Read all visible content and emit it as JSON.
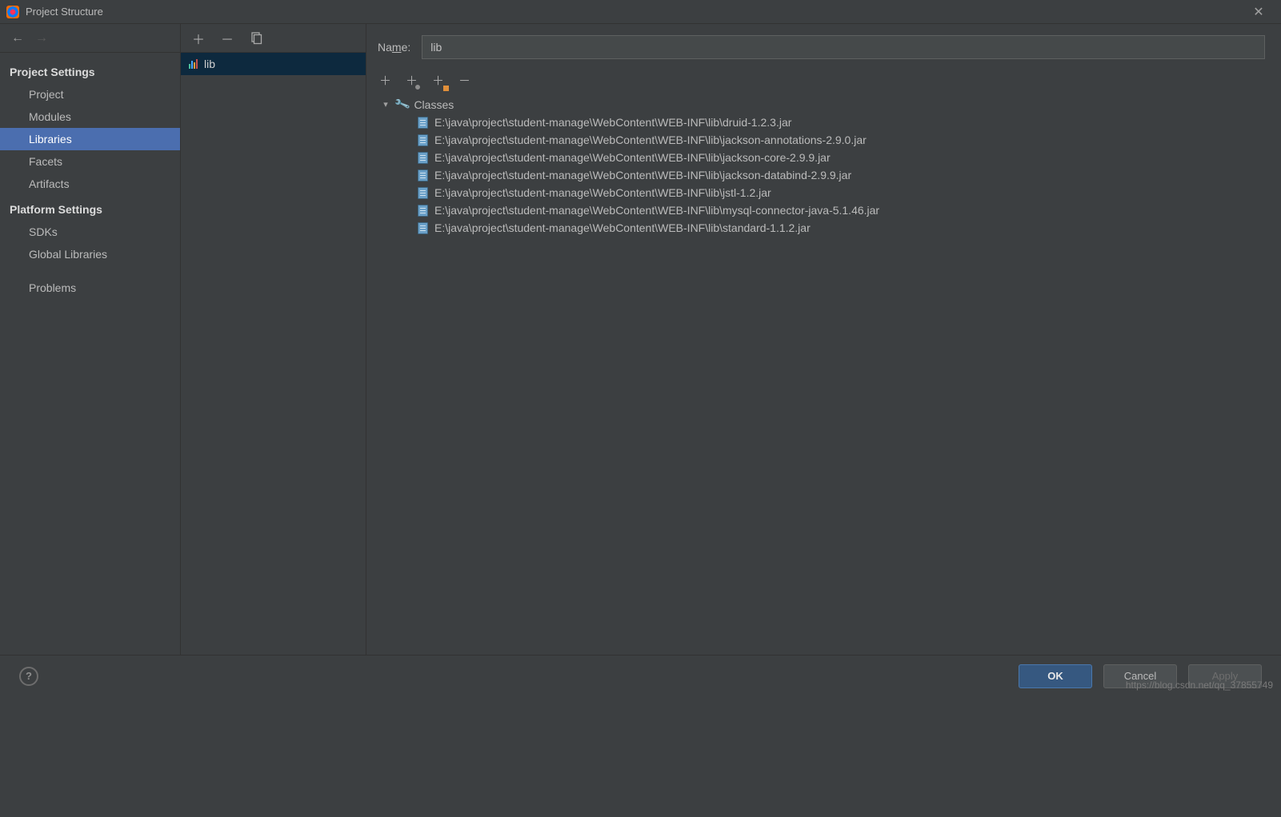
{
  "window": {
    "title": "Project Structure"
  },
  "sidebar": {
    "headings": {
      "project": "Project Settings",
      "platform": "Platform Settings"
    },
    "project_items": [
      "Project",
      "Modules",
      "Libraries",
      "Facets",
      "Artifacts"
    ],
    "platform_items": [
      "SDKs",
      "Global Libraries"
    ],
    "standalone": "Problems",
    "selected": "Libraries"
  },
  "midpanel": {
    "items": [
      {
        "name": "lib"
      }
    ],
    "selected": "lib"
  },
  "detail": {
    "name_label_pre": "Na",
    "name_label_u": "m",
    "name_label_post": "e:",
    "name_value": "lib",
    "tree_root": "Classes",
    "classes": [
      "E:\\java\\project\\student-manage\\WebContent\\WEB-INF\\lib\\druid-1.2.3.jar",
      "E:\\java\\project\\student-manage\\WebContent\\WEB-INF\\lib\\jackson-annotations-2.9.0.jar",
      "E:\\java\\project\\student-manage\\WebContent\\WEB-INF\\lib\\jackson-core-2.9.9.jar",
      "E:\\java\\project\\student-manage\\WebContent\\WEB-INF\\lib\\jackson-databind-2.9.9.jar",
      "E:\\java\\project\\student-manage\\WebContent\\WEB-INF\\lib\\jstl-1.2.jar",
      "E:\\java\\project\\student-manage\\WebContent\\WEB-INF\\lib\\mysql-connector-java-5.1.46.jar",
      "E:\\java\\project\\student-manage\\WebContent\\WEB-INF\\lib\\standard-1.1.2.jar"
    ]
  },
  "footer": {
    "ok": "OK",
    "cancel": "Cancel",
    "apply": "Apply"
  },
  "watermark": "https://blog.csdn.net/qq_37855749"
}
